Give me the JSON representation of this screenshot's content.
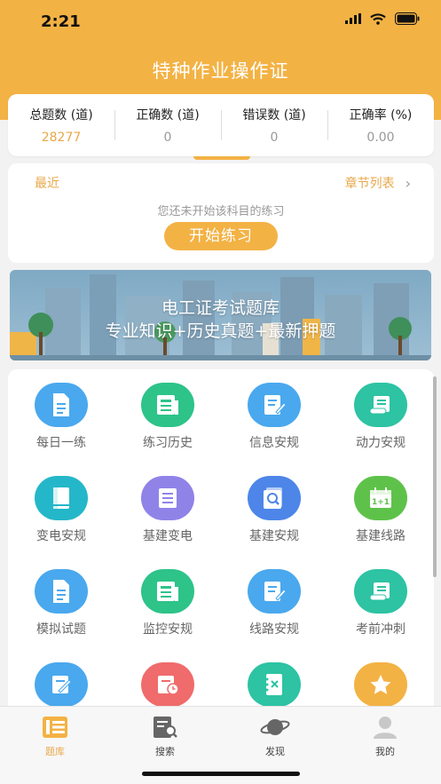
{
  "status": {
    "time": "2:21"
  },
  "header": {
    "title": "特种作业操作证"
  },
  "stats": [
    {
      "label": "总题数 (道)",
      "value": "28277"
    },
    {
      "label": "正确数 (道)",
      "value": "0"
    },
    {
      "label": "错误数 (道)",
      "value": "0"
    },
    {
      "label": "正确率 (%)",
      "value": "0.00"
    }
  ],
  "recent": {
    "label": "最近",
    "chapter_link": "章节列表",
    "hint": "您还未开始该科目的练习",
    "start_button": "开始练习"
  },
  "banner": {
    "line1": "电工证考试题库",
    "line2": "专业知识+历史真题+最新押题"
  },
  "grid": [
    {
      "label": "每日一练",
      "icon": "document-icon",
      "color": "#4aa8ee"
    },
    {
      "label": "练习历史",
      "icon": "list-document-icon",
      "color": "#2dc389"
    },
    {
      "label": "信息安规",
      "icon": "edit-document-icon",
      "color": "#4aa8ee"
    },
    {
      "label": "动力安规",
      "icon": "scroll-icon",
      "color": "#2dc3a3"
    },
    {
      "label": "变电安规",
      "icon": "book-icon",
      "color": "#24b7c9"
    },
    {
      "label": "基建变电",
      "icon": "list-document-icon",
      "color": "#8f83e8"
    },
    {
      "label": "基建安规",
      "icon": "search-document-icon",
      "color": "#4d86e8"
    },
    {
      "label": "基建线路",
      "icon": "calendar-plus-icon",
      "color": "#5ec24a"
    },
    {
      "label": "模拟试题",
      "icon": "document-icon",
      "color": "#4aa8ee"
    },
    {
      "label": "监控安规",
      "icon": "list-document-icon",
      "color": "#2dc389"
    },
    {
      "label": "线路安规",
      "icon": "edit-document-icon",
      "color": "#4aa8ee"
    },
    {
      "label": "考前冲刺",
      "icon": "scroll-icon",
      "color": "#2dc3a3"
    },
    {
      "label": "",
      "icon": "pencil-document-icon",
      "color": "#4aa8ee"
    },
    {
      "label": "",
      "icon": "clock-document-icon",
      "color": "#f06b6b"
    },
    {
      "label": "",
      "icon": "notebook-x-icon",
      "color": "#2dc3a3"
    },
    {
      "label": "",
      "icon": "star-icon",
      "color": "#f3b244"
    }
  ],
  "tabs": [
    {
      "label": "题库",
      "icon": "question-bank-icon",
      "active": true
    },
    {
      "label": "搜索",
      "icon": "search-icon",
      "active": false
    },
    {
      "label": "发现",
      "icon": "planet-icon",
      "active": false
    },
    {
      "label": "我的",
      "icon": "user-icon",
      "active": false
    }
  ],
  "colors": {
    "accent": "#f3b244",
    "accent_text": "#e8a84a"
  }
}
